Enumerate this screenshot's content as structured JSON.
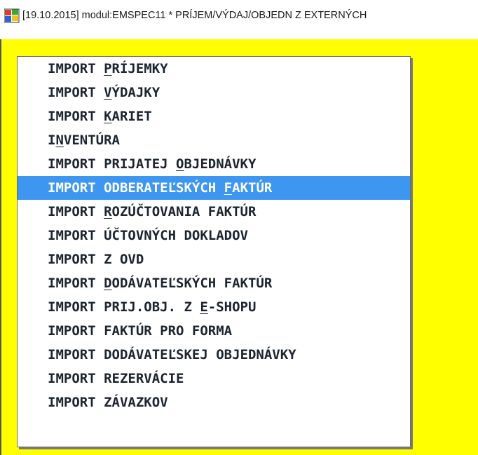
{
  "window": {
    "title": "[19.10.2015] modul:EMSPEC11 * PRÍJEM/VÝDAJ/OBJEDN Z EXTERNÝCH",
    "app_icon": "colorful-windows-app-icon"
  },
  "colors": {
    "desktop_background": "#ffff00",
    "menu_background": "#ffffff",
    "selection": "#3d96ef",
    "text": "#1c2530"
  },
  "menu": {
    "selected_index": 5,
    "items": [
      {
        "pre": "IMPORT ",
        "key": "P",
        "post": "RÍJEMKY"
      },
      {
        "pre": "IMPORT ",
        "key": "V",
        "post": "ÝDAJKY"
      },
      {
        "pre": "IMPORT ",
        "key": "K",
        "post": "ARIET"
      },
      {
        "pre": "I",
        "key": "N",
        "post": "VENTÚRA"
      },
      {
        "pre": "IMPORT PRIJATEJ ",
        "key": "O",
        "post": "BJEDNÁVKY"
      },
      {
        "pre": "IMPORT ODBERATEĽSKÝCH ",
        "key": "F",
        "post": "AKTÚR"
      },
      {
        "pre": "IMPORT ",
        "key": "R",
        "post": "OZÚČTOVANIA FAKTÚR"
      },
      {
        "pre": "IMPORT ÚČTOVNÝCH DOKLADOV",
        "key": "",
        "post": ""
      },
      {
        "pre": "IMPORT Z OVD",
        "key": "",
        "post": ""
      },
      {
        "pre": "IMPORT ",
        "key": "D",
        "post": "ODÁVATEĽSKÝCH FAKTÚR"
      },
      {
        "pre": "IMPORT PRIJ.OBJ. Z ",
        "key": "E",
        "post": "-SHOPU"
      },
      {
        "pre": "IMPORT FAKTÚR PRO FORMA",
        "key": "",
        "post": ""
      },
      {
        "pre": "IMPORT DODÁVATEĽSKEJ OBJEDNÁVKY",
        "key": "",
        "post": ""
      },
      {
        "pre": "IMPORT REZERVÁCIE",
        "key": "",
        "post": ""
      },
      {
        "pre": "IMPORT ZÁVAZKOV",
        "key": "",
        "post": ""
      }
    ]
  }
}
